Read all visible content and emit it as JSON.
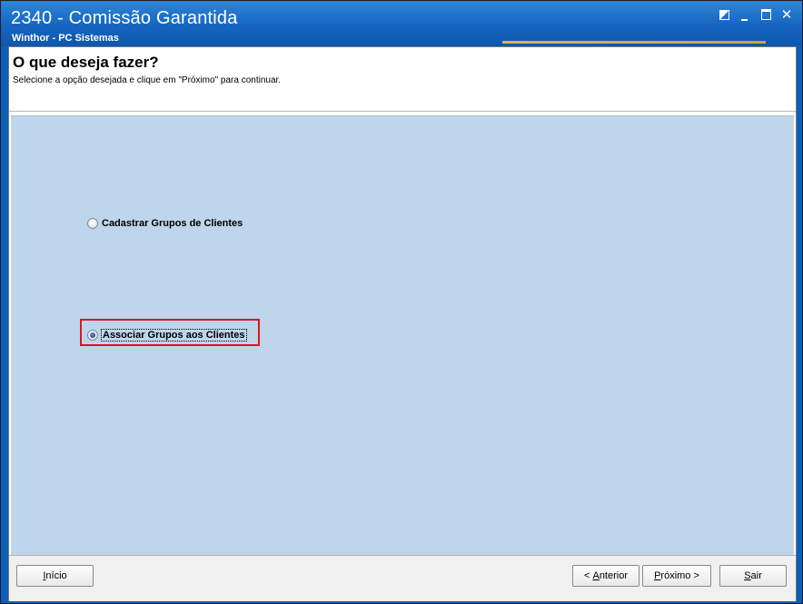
{
  "window": {
    "title": "2340 - Comissão Garantida",
    "subtitle": "Winthor - PC Sistemas",
    "controls": {
      "restore": "",
      "minimize": "",
      "maximize": "",
      "close": "✕"
    }
  },
  "header": {
    "title": "O que deseja fazer?",
    "description": "Selecione a opção desejada e clique em \"Próximo\" para continuar."
  },
  "options": [
    {
      "label": "Cadastrar Grupos de Clientes",
      "selected": false
    },
    {
      "label": "Associar Grupos aos Clientes",
      "selected": true
    }
  ],
  "footer": {
    "inicio": {
      "accel": "I",
      "rest": "nício"
    },
    "anterior": {
      "pre": "< ",
      "accel": "A",
      "rest": "nterior"
    },
    "proximo": {
      "accel": "P",
      "rest": "róximo >"
    },
    "sair": {
      "accel": "S",
      "rest": "air"
    }
  },
  "colors": {
    "title_bar": "#1565c0",
    "panel": "#bfd5ec",
    "highlight": "#e0151c"
  }
}
